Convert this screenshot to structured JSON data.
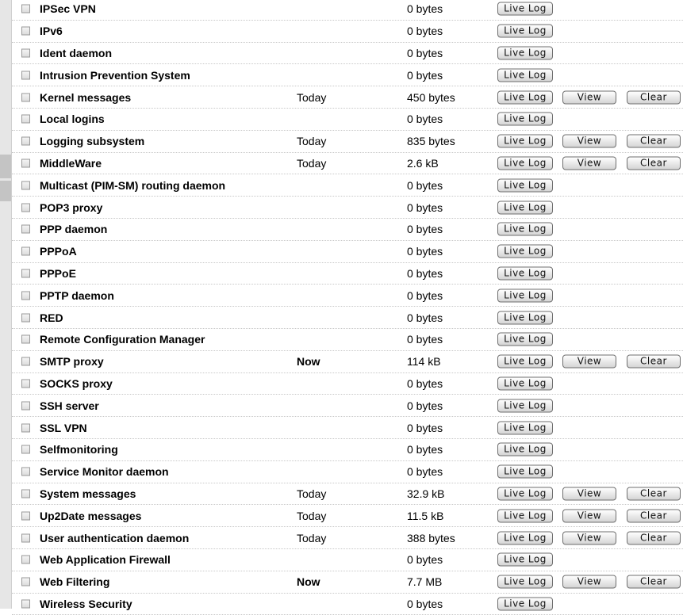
{
  "buttons": {
    "live_log": "Live Log",
    "view": "View",
    "clear": "Clear"
  },
  "rows": [
    {
      "name": "IPSec VPN",
      "date": "",
      "size": "0 bytes",
      "actions": false,
      "now": false
    },
    {
      "name": "IPv6",
      "date": "",
      "size": "0 bytes",
      "actions": false,
      "now": false
    },
    {
      "name": "Ident daemon",
      "date": "",
      "size": "0 bytes",
      "actions": false,
      "now": false
    },
    {
      "name": "Intrusion Prevention System",
      "date": "",
      "size": "0 bytes",
      "actions": false,
      "now": false
    },
    {
      "name": "Kernel messages",
      "date": "Today",
      "size": "450 bytes",
      "actions": true,
      "now": false
    },
    {
      "name": "Local logins",
      "date": "",
      "size": "0 bytes",
      "actions": false,
      "now": false
    },
    {
      "name": "Logging subsystem",
      "date": "Today",
      "size": "835 bytes",
      "actions": true,
      "now": false
    },
    {
      "name": "MiddleWare",
      "date": "Today",
      "size": "2.6 kB",
      "actions": true,
      "now": false
    },
    {
      "name": "Multicast (PIM-SM) routing daemon",
      "date": "",
      "size": "0 bytes",
      "actions": false,
      "now": false
    },
    {
      "name": "POP3 proxy",
      "date": "",
      "size": "0 bytes",
      "actions": false,
      "now": false
    },
    {
      "name": "PPP daemon",
      "date": "",
      "size": "0 bytes",
      "actions": false,
      "now": false
    },
    {
      "name": "PPPoA",
      "date": "",
      "size": "0 bytes",
      "actions": false,
      "now": false
    },
    {
      "name": "PPPoE",
      "date": "",
      "size": "0 bytes",
      "actions": false,
      "now": false
    },
    {
      "name": "PPTP daemon",
      "date": "",
      "size": "0 bytes",
      "actions": false,
      "now": false
    },
    {
      "name": "RED",
      "date": "",
      "size": "0 bytes",
      "actions": false,
      "now": false
    },
    {
      "name": "Remote Configuration Manager",
      "date": "",
      "size": "0 bytes",
      "actions": false,
      "now": false
    },
    {
      "name": "SMTP proxy",
      "date": "Now",
      "size": "114 kB",
      "actions": true,
      "now": true
    },
    {
      "name": "SOCKS proxy",
      "date": "",
      "size": "0 bytes",
      "actions": false,
      "now": false
    },
    {
      "name": "SSH server",
      "date": "",
      "size": "0 bytes",
      "actions": false,
      "now": false
    },
    {
      "name": "SSL VPN",
      "date": "",
      "size": "0 bytes",
      "actions": false,
      "now": false
    },
    {
      "name": "Selfmonitoring",
      "date": "",
      "size": "0 bytes",
      "actions": false,
      "now": false
    },
    {
      "name": "Service Monitor daemon",
      "date": "",
      "size": "0 bytes",
      "actions": false,
      "now": false
    },
    {
      "name": "System messages",
      "date": "Today",
      "size": "32.9 kB",
      "actions": true,
      "now": false
    },
    {
      "name": "Up2Date messages",
      "date": "Today",
      "size": "11.5 kB",
      "actions": true,
      "now": false
    },
    {
      "name": "User authentication daemon",
      "date": "Today",
      "size": "388 bytes",
      "actions": true,
      "now": false
    },
    {
      "name": "Web Application Firewall",
      "date": "",
      "size": "0 bytes",
      "actions": false,
      "now": false
    },
    {
      "name": "Web Filtering",
      "date": "Now",
      "size": "7.7 MB",
      "actions": true,
      "now": true
    },
    {
      "name": "Wireless Security",
      "date": "",
      "size": "0 bytes",
      "actions": false,
      "now": false
    }
  ]
}
